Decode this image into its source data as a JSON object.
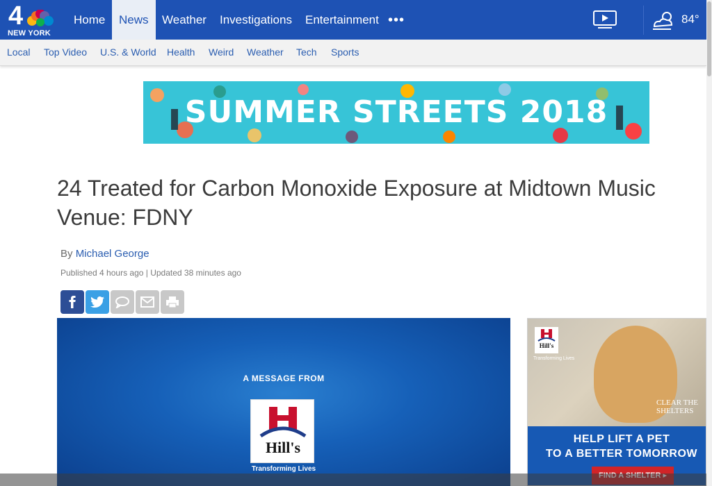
{
  "brand": {
    "number": "4",
    "city": "NEW YORK",
    "accent": "#1e52b4"
  },
  "topnav": {
    "items": [
      {
        "label": "Home",
        "active": false
      },
      {
        "label": "News",
        "active": true
      },
      {
        "label": "Weather",
        "active": false
      },
      {
        "label": "Investigations",
        "active": false
      },
      {
        "label": "Entertainment",
        "active": false
      }
    ],
    "more_label": "•••",
    "video_icon": "play-video-icon",
    "weather": {
      "icon": "partly-cloudy-icon",
      "temp": "84°"
    }
  },
  "subnav": {
    "items": [
      "Local",
      "Top Video",
      "U.S. & World",
      "Health",
      "Weird",
      "Weather",
      "Tech",
      "Sports"
    ]
  },
  "banner": {
    "text": "SUMMER STREETS 2018",
    "bg": "#37c4d7"
  },
  "article": {
    "headline": "24 Treated for Carbon Monoxide Exposure at Midtown Music Venue: FDNY",
    "byline_prefix": "By",
    "author": "Michael George",
    "timestamp": "Published 4 hours ago | Updated 38 minutes ago",
    "share": [
      {
        "icon": "facebook-icon",
        "color": "#2d4e96"
      },
      {
        "icon": "twitter-icon",
        "color": "#3aa0e5"
      },
      {
        "icon": "comment-icon",
        "color": "#c8c8c8"
      },
      {
        "icon": "email-icon",
        "color": "#c8c8c8"
      },
      {
        "icon": "print-icon",
        "color": "#c8c8c8"
      }
    ]
  },
  "video_ad": {
    "message": "A MESSAGE FROM",
    "brand": "Hill's",
    "tagline": "Transforming Lives"
  },
  "side_ad": {
    "brand": "Hill's",
    "brand_tag": "Transforming Lives",
    "partner": "CLEAR THE SHELTERS",
    "line1": "HELP LIFT A PET",
    "line2": "TO A BETTER TOMORROW",
    "cta": "FIND A SHELTER ▸"
  }
}
